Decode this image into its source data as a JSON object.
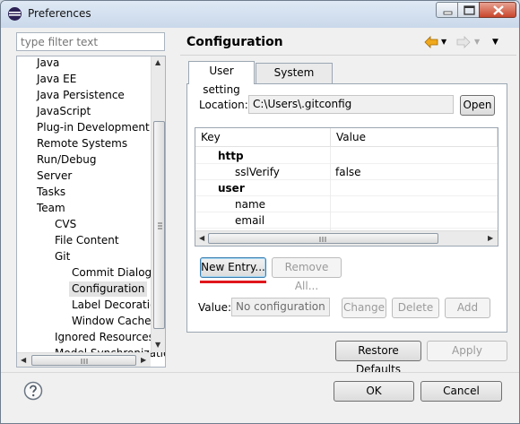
{
  "window": {
    "title": "Preferences",
    "controls": {
      "minimize_icon": "minimize-icon",
      "maximize_icon": "maximize-icon",
      "close_icon": "close-icon"
    }
  },
  "filter": {
    "placeholder": "type filter text",
    "value": ""
  },
  "tree": {
    "items": [
      {
        "label": "Java",
        "level": 0
      },
      {
        "label": "Java EE",
        "level": 0
      },
      {
        "label": "Java Persistence",
        "level": 0
      },
      {
        "label": "JavaScript",
        "level": 0
      },
      {
        "label": "Plug-in Development",
        "level": 0
      },
      {
        "label": "Remote Systems",
        "level": 0
      },
      {
        "label": "Run/Debug",
        "level": 0
      },
      {
        "label": "Server",
        "level": 0
      },
      {
        "label": "Tasks",
        "level": 0
      },
      {
        "label": "Team",
        "level": 0
      },
      {
        "label": "CVS",
        "level": 1
      },
      {
        "label": "File Content",
        "level": 1
      },
      {
        "label": "Git",
        "level": 1
      },
      {
        "label": "Commit Dialog",
        "level": 2
      },
      {
        "label": "Configuration",
        "level": 2,
        "selected": true
      },
      {
        "label": "Label Decoration",
        "level": 2
      },
      {
        "label": "Window Cache",
        "level": 2
      },
      {
        "label": "Ignored Resources",
        "level": 1
      },
      {
        "label": "Model Synchronization",
        "level": 1
      }
    ]
  },
  "panel": {
    "title": "Configuration",
    "nav": {
      "back_icon": "back-arrow-icon",
      "forward_icon": "forward-arrow-icon",
      "menu_icon": "view-menu-icon"
    },
    "tabs": [
      {
        "label": "User setting",
        "active": true
      },
      {
        "label": "System setting",
        "active": false
      }
    ],
    "location_label": "Location:",
    "location_value": "C:\\Users\\.gitconfig",
    "open_button": "Open",
    "table": {
      "headers": [
        "Key",
        "Value"
      ],
      "rows": [
        {
          "key": "http",
          "value": "",
          "section": true
        },
        {
          "key": "sslVerify",
          "value": "false",
          "section": false
        },
        {
          "key": "user",
          "value": "",
          "section": true
        },
        {
          "key": "name",
          "value": "",
          "section": false
        },
        {
          "key": "email",
          "value": "",
          "section": false
        }
      ]
    },
    "new_entry_button": "New Entry...",
    "remove_all_button": "Remove All...",
    "value_label": "Value:",
    "value_placeholder": "No configuration entry selected",
    "change_button": "Change",
    "delete_button": "Delete",
    "add_button": "Add",
    "restore_defaults_button": "Restore Defaults",
    "apply_button": "Apply"
  },
  "footer": {
    "ok_button": "OK",
    "cancel_button": "Cancel"
  },
  "colors": {
    "highlight_underline": "#e0161b",
    "nav_back_arrow": "#f0a81c"
  }
}
